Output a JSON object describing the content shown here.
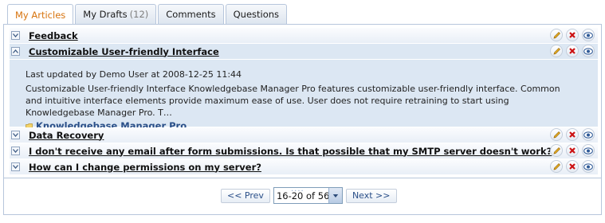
{
  "tabs": [
    {
      "label": "My Articles",
      "count": ""
    },
    {
      "label": "My Drafts",
      "count": "(12)"
    },
    {
      "label": "Comments",
      "count": ""
    },
    {
      "label": "Questions",
      "count": ""
    }
  ],
  "articles": [
    {
      "title": "Feedback"
    },
    {
      "title": "Customizable User-friendly Interface"
    },
    {
      "title": "Data Recovery"
    },
    {
      "title": "I don't receive any email after form submissions. Is that possible that my SMTP server doesn't work?"
    },
    {
      "title": "How can I change permissions on my server?"
    }
  ],
  "expanded": {
    "updated": "Last updated by Demo User at 2008-12-25 11:44",
    "body": "Customizable User-friendly Interface Knowledgebase Manager Pro features customizable user-friendly interface. Common and intuitive interface elements provide maximum ease of use. User does not require retraining to start using Knowledgebase Manager Pro. T…",
    "category_link": "Knowledgebase Manager Pro"
  },
  "pager": {
    "prev": "<< Prev",
    "range": "16-20 of 56",
    "next": "Next >>"
  },
  "resize_handle": "....",
  "icons": [
    "chevron-down-icon",
    "chevron-up-icon",
    "pencil-icon",
    "delete-icon",
    "eye-icon",
    "folder-icon"
  ],
  "colors": {
    "active_tab_text": "#d7730d",
    "link": "#2a4f88",
    "expanded_bg": "#dce7f3",
    "delete_red": "#cc1111"
  }
}
